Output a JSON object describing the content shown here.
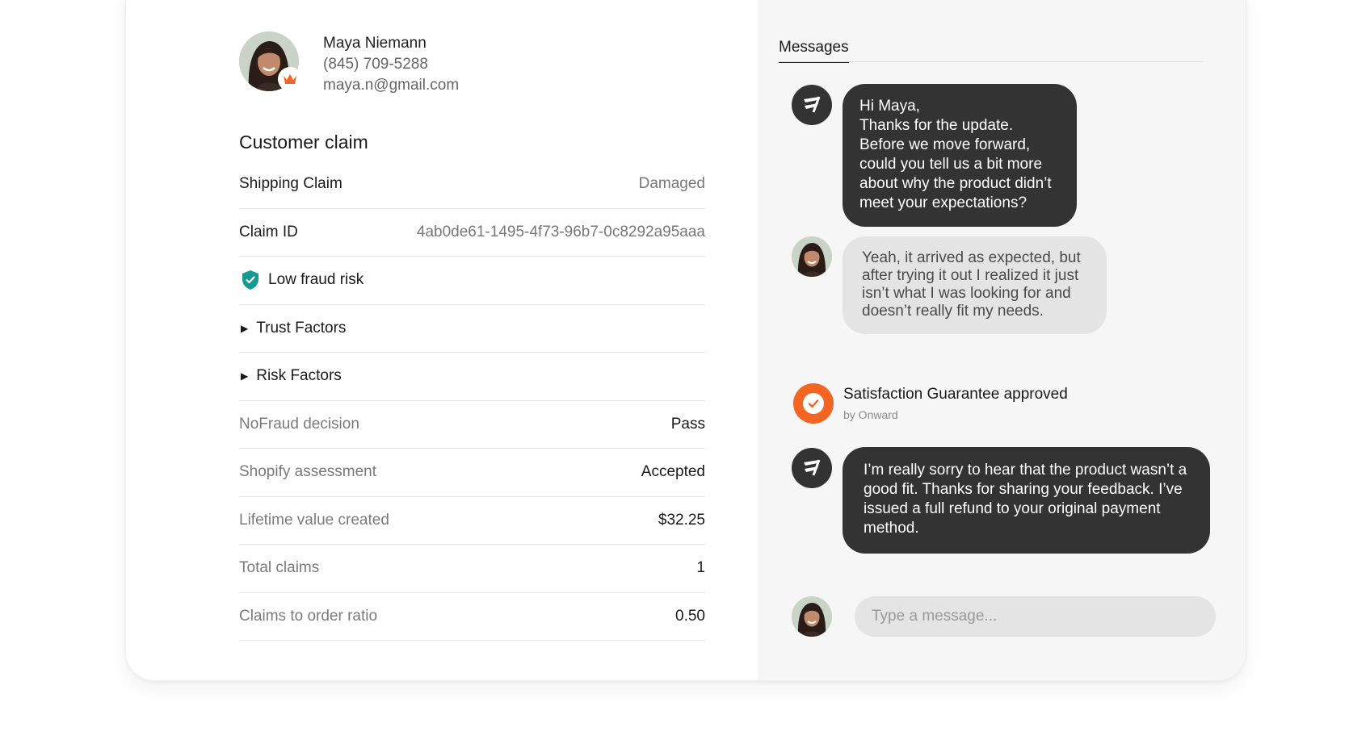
{
  "customer": {
    "name": "Maya Niemann",
    "phone": "(845) 709-5288",
    "email": "maya.n@gmail.com"
  },
  "claim": {
    "section_title": "Customer claim",
    "rows": [
      {
        "label": "Shipping Claim",
        "value": "Damaged"
      },
      {
        "label": "Claim ID",
        "value": "4ab0de61-1495-4f73-96b7-0c8292a95aaa"
      },
      {
        "label": "Low fraud risk"
      },
      {
        "label": "Trust Factors"
      },
      {
        "label": "Risk Factors"
      },
      {
        "label": "NoFraud decision",
        "value": "Pass"
      },
      {
        "label": "Shopify assessment",
        "value": "Accepted"
      },
      {
        "label": "Lifetime value created",
        "value": "$32.25"
      },
      {
        "label": "Total claims",
        "value": "1"
      },
      {
        "label": "Claims to order ratio",
        "value": "0.50"
      }
    ]
  },
  "messages": {
    "tab_label": "Messages",
    "items": [
      {
        "from": "brand",
        "text": "Hi Maya,\nThanks for the update. Before we move forward, could you tell us a bit more about why the product didn’t meet your expectations?"
      },
      {
        "from": "customer",
        "text": "Yeah, it arrived as expected, but after trying it out I realized it just isn’t what I was looking for and doesn’t really fit my needs."
      },
      {
        "from": "brand",
        "text": "I’m really sorry to hear that the product wasn’t a good fit. Thanks for sharing your feedback. I’ve issued a full refund to your original payment method."
      }
    ],
    "event": {
      "title": "Satisfaction Guarantee approved",
      "subtitle": "by Onward"
    },
    "composer_placeholder": "Type a message..."
  },
  "colors": {
    "accent_orange": "#f26522",
    "shield_teal": "#159a92",
    "bubble_dark": "#333333",
    "bubble_light": "#e4e4e4"
  },
  "icons": [
    "crown-icon",
    "shield-check-icon",
    "triangle-right-icon",
    "brand-logo-icon",
    "check-circle-icon"
  ]
}
